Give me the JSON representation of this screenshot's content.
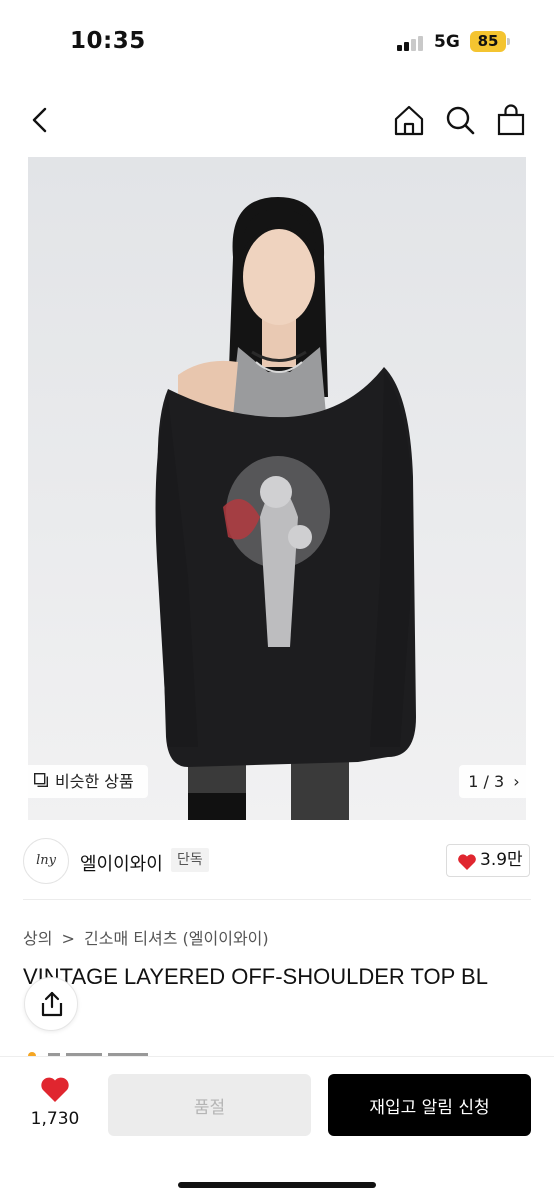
{
  "status": {
    "time": "10:35",
    "network": "5G",
    "battery": "85"
  },
  "colors": {
    "battery_bg": "#f4c430",
    "accent_red": "#e0262f",
    "cta_bg": "#000000",
    "disabled_bg": "#ececec"
  },
  "nav": {
    "icons": [
      "back-icon",
      "home-icon",
      "search-icon",
      "shopping-bag-icon"
    ]
  },
  "gallery": {
    "similar_label": "비슷한 상품",
    "page_indicator": "1 / 3",
    "page_chevron": "›"
  },
  "brand": {
    "logo_text": "lny",
    "name": "엘이이와이",
    "tag": "단독",
    "likes": "3.9만"
  },
  "product": {
    "breadcrumb": [
      "상의",
      "긴소매 티셔츠 (엘이이와이)"
    ],
    "breadcrumb_sep": ">",
    "title": "VINTAGE LAYERED OFF-SHOULDER TOP BL"
  },
  "bottom": {
    "wish_count": "1,730",
    "soldout_label": "품절",
    "restock_label": "재입고 알림 신청"
  }
}
